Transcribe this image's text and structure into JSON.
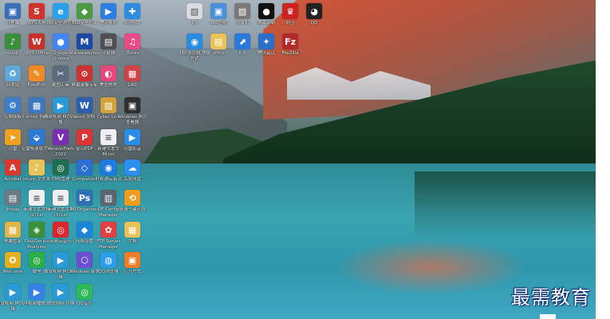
{
  "desktop": {
    "icons": [
      {
        "label": "此电脑",
        "glyph": "▣",
        "color": "#3a6fb7"
      },
      {
        "label": "WPS表格",
        "glyph": "S",
        "color": "#d1342f"
      },
      {
        "label": "360安全浏览器",
        "glyph": "e",
        "color": "#2aa1e8"
      },
      {
        "label": "360安全卫士",
        "glyph": "◆",
        "color": "#4c9a44"
      },
      {
        "label": "腾讯视频",
        "glyph": "▶",
        "color": "#2e7de0"
      },
      {
        "label": "极速PDF",
        "glyph": "✚",
        "color": "#2d8ce0"
      },
      {
        "label": "music",
        "glyph": "♪",
        "color": "#3c8e3c"
      },
      {
        "label": "WPS Office",
        "glyph": "W",
        "color": "#c8302b"
      },
      {
        "label": "Google Chrome",
        "glyph": "●",
        "color": "#4285f4"
      },
      {
        "label": "Malwarebytes",
        "glyph": "M",
        "color": "#1b4aa3"
      },
      {
        "label": "计算器",
        "glyph": "▤",
        "color": "#4f4f55"
      },
      {
        "label": "iTunes",
        "glyph": "♫",
        "color": "#e94b86"
      },
      {
        "label": "回收站",
        "glyph": "♻",
        "color": "#5fa8d8"
      },
      {
        "label": "EverEdit",
        "glyph": "✎",
        "color": "#f08a24"
      },
      {
        "label": "截图工具",
        "glyph": "✂",
        "color": "#5b6d7c"
      },
      {
        "label": "屏幕录像专家",
        "glyph": "⊙",
        "color": "#c33"
      },
      {
        "label": "美图秀秀",
        "glyph": "◐",
        "color": "#e5487d"
      },
      {
        "label": "LAO",
        "glyph": "▦",
        "color": "#c44"
      },
      {
        "label": "控制面板",
        "glyph": "⚙",
        "color": "#3d7dc9"
      },
      {
        "label": "Control Panel",
        "glyph": "▦",
        "color": "#3b78c0"
      },
      {
        "label": "傲软视频 MOV转换",
        "glyph": "▶",
        "color": "#2a9ad6"
      },
      {
        "label": "word 文档",
        "glyph": "W",
        "color": "#2b5fb0"
      },
      {
        "label": "Cyber Link",
        "glyph": "▨",
        "color": "#d4a23a"
      },
      {
        "label": "Windows 照片查看器",
        "glyph": "▣",
        "color": "#2f2f2f"
      },
      {
        "label": "迅雷",
        "glyph": "➤",
        "color": "#f0a020"
      },
      {
        "label": "迅雷极速版大师",
        "glyph": "⬙",
        "color": "#2c7ad0"
      },
      {
        "label": "VersionPrefs 2022",
        "glyph": "V",
        "color": "#7a2fb0"
      },
      {
        "label": "金山PDF",
        "glyph": "P",
        "color": "#d33"
      },
      {
        "label": "新建文本文档.txt",
        "glyph": "≡",
        "color": "#eef0f3"
      },
      {
        "label": "迅雷影音",
        "glyph": "▶",
        "color": "#2a8ce8"
      },
      {
        "label": "Acrobat",
        "glyph": "A",
        "color": "#d93a2f"
      },
      {
        "label": "music 文件夹",
        "glyph": "♪",
        "color": "#e8c35a"
      },
      {
        "label": "CMS管理",
        "glyph": "◎",
        "color": "#1f6e4f"
      },
      {
        "label": "Companion",
        "glyph": "◇",
        "color": "#2b6fd3"
      },
      {
        "label": "好视通云会议",
        "glyph": "◉",
        "color": "#1d7ae0"
      },
      {
        "label": "百度网盘",
        "glyph": "☁",
        "color": "#2d8ef0"
      },
      {
        "label": "Image",
        "glyph": "▤",
        "color": "#6a7a86"
      },
      {
        "label": "新建文本文档 (2).txt",
        "glyph": "≡",
        "color": "#eef0f3"
      },
      {
        "label": "新建文本文档 (3).txt",
        "glyph": "≡",
        "color": "#eef0f3"
      },
      {
        "label": "PS Organizer",
        "glyph": "Ps",
        "color": "#2f6fb6"
      },
      {
        "label": "OF Config Manager",
        "glyph": "▥",
        "color": "#5a6570"
      },
      {
        "label": "极速一键还原",
        "glyph": "⟲",
        "color": "#f29c1f"
      },
      {
        "label": "电脑管家",
        "glyph": "▦",
        "color": "#e0b64a"
      },
      {
        "label": "DiskGenius Analyzer",
        "glyph": "◈",
        "color": "#3a8f3a"
      },
      {
        "label": "网易云音乐",
        "glyph": "◎",
        "color": "#d9272e"
      },
      {
        "label": "网络设置",
        "glyph": "◆",
        "color": "#1b86d8"
      },
      {
        "label": "FTP Server Manager",
        "glyph": "✿",
        "color": "#e04040"
      },
      {
        "label": "文档",
        "glyph": "▦",
        "color": "#e8c35a"
      },
      {
        "label": "Welcome",
        "glyph": "✪",
        "color": "#e0b020"
      },
      {
        "label": "微信",
        "glyph": "◎",
        "color": "#2aae48"
      },
      {
        "label": "傲软视频 MOV剪辑",
        "glyph": "▶",
        "color": "#2a9ad6"
      },
      {
        "label": "Windows 媒体",
        "glyph": "⬡",
        "color": "#6a4fd1"
      },
      {
        "label": "QQ浏览器",
        "glyph": "◍",
        "color": "#2a9ee8"
      },
      {
        "label": "打开方式",
        "glyph": "▣",
        "color": "#f07c2a"
      },
      {
        "label": "傲软视频 MOV剪辑",
        "glyph": "▶",
        "color": "#2a9ad6"
      },
      {
        "label": "视频播放",
        "glyph": "▶",
        "color": "#3582e6"
      },
      {
        "label": "傲软视频 转换",
        "glyph": "▶",
        "color": "#2a9ad6"
      },
      {
        "label": "QQ音乐",
        "glyph": "◎",
        "color": "#2fb859"
      },
      {
        "label": "PS",
        "glyph": "▨",
        "color": "#d8dbe0"
      },
      {
        "label": "360压缩",
        "glyph": "▣",
        "color": "#4a90d9"
      },
      {
        "label": "计算机",
        "glyph": "▨",
        "color": "#7a7a7a"
      },
      {
        "label": "屏幕录制",
        "glyph": "●",
        "color": "#111"
      },
      {
        "label": "好压",
        "glyph": "♛",
        "color": "#c22"
      },
      {
        "label": "QQ",
        "glyph": "◕",
        "color": "#222"
      },
      {
        "label": "360浏览器 快捷方式",
        "glyph": "◉",
        "color": "#2a8be0"
      },
      {
        "label": "office",
        "glyph": "▤",
        "color": "#e8c35a"
      },
      {
        "label": "k 8",
        "glyph": "⬈",
        "color": "#2a78d8"
      },
      {
        "label": "腾讯会议",
        "glyph": "✦",
        "color": "#2a6fc9"
      },
      {
        "label": "FileZilla",
        "glyph": "Fz",
        "color": "#b32a2a"
      }
    ]
  },
  "watermark": {
    "text": "最需教育"
  }
}
